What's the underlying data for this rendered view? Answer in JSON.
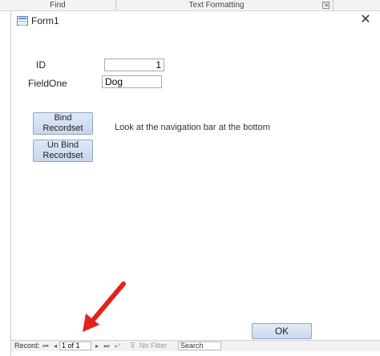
{
  "ribbon": {
    "find_label": "Find",
    "text_formatting_label": "Text Formatting",
    "launcher_glyph": "⇲"
  },
  "form": {
    "title": "Form1",
    "close_glyph": "✕",
    "id_label": "ID",
    "id_value": "1",
    "fieldone_label": "FieldOne",
    "fieldone_value": "Dog",
    "bind_button_line1": "Bind",
    "bind_button_line2": "Recordset",
    "unbind_button_line1": "Un Bind",
    "unbind_button_line2": "Recordset",
    "instruction_text": "Look at the navigation bar at the bottom",
    "ok_label": "OK"
  },
  "navbar": {
    "record_label": "Record:",
    "first_glyph": "⏮",
    "prev_glyph": "◂",
    "current_record": "1 of 1",
    "next_glyph": "▸",
    "last_glyph": "⏭",
    "new_glyph": "▸*",
    "filter_icon_glyph": "⊽",
    "filter_label": "No Filter",
    "search_placeholder": "Search"
  },
  "colors": {
    "annotation_arrow": "#e0241b",
    "button_fill": "#c8d7ec"
  }
}
